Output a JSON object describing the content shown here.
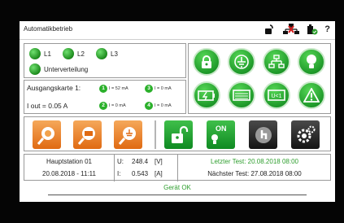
{
  "window": {
    "title": "Automatikbetrieb"
  },
  "toolbar": {
    "icons": [
      "unlock-icon",
      "network-error-icon",
      "battery-ok-icon",
      "help-icon"
    ],
    "help_label": "?"
  },
  "phases": {
    "items": [
      {
        "label": "L1",
        "status": "on"
      },
      {
        "label": "L2",
        "status": "on"
      },
      {
        "label": "L3",
        "status": "on"
      },
      {
        "label": "Unterverteilung",
        "status": "on"
      }
    ]
  },
  "output_card": {
    "title": "Ausgangskarte 1:",
    "iout": "I out = 0.05 A",
    "channels": [
      {
        "num": "1",
        "value": "I = 52 mA"
      },
      {
        "num": "3",
        "value": "I = 0 mA"
      },
      {
        "num": "2",
        "value": "I = 0 mA"
      },
      {
        "num": "4",
        "value": "I = 0 mA"
      }
    ]
  },
  "function_grid": {
    "buttons": [
      "lock-icon",
      "ground-icon",
      "network-icon",
      "lamp-icon",
      "battery-charge-icon",
      "lamp-panel-icon",
      "undervoltage-icon",
      "warning-icon"
    ]
  },
  "actions": {
    "on_label": "ON"
  },
  "status": {
    "station": "Hauptstation 01",
    "datetime": "20.08.2018 - 11:11",
    "u_label": "U:",
    "u_value": "248.4",
    "u_unit": "[V]",
    "i_label": "I:",
    "i_value": "0.543",
    "i_unit": "[A]",
    "last_test": "Letzter Test: 20.08.2018 08:00",
    "next_test": "Nächster Test: 27.08.2018 08:00"
  },
  "device_status": "Gerät OK",
  "colors": {
    "accent_green": "#2e9e2e",
    "button_green": "#1f9a2a",
    "button_orange": "#e06a12"
  }
}
